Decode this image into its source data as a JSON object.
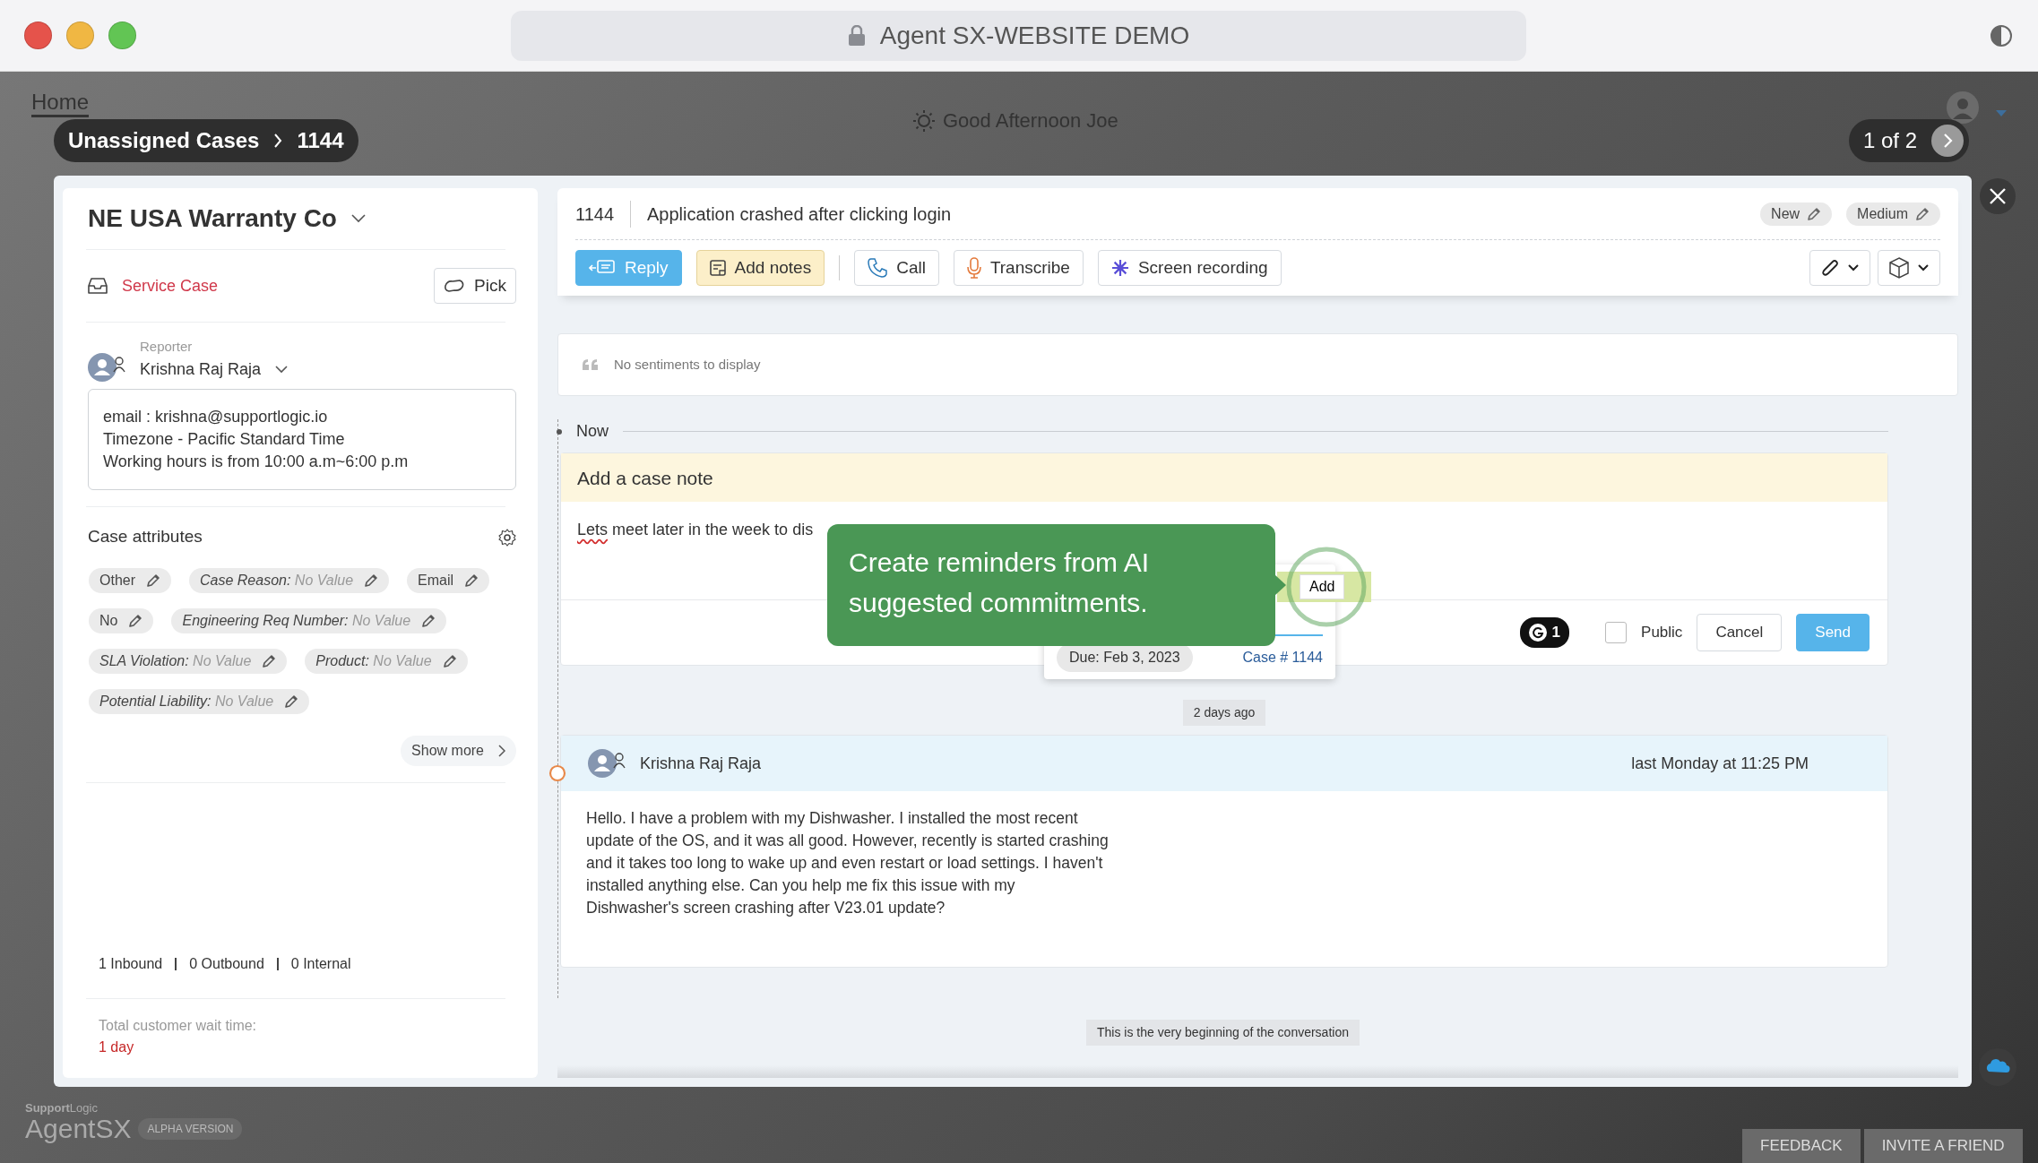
{
  "window": {
    "title": "Agent SX-WEBSITE DEMO"
  },
  "backdrop": {
    "home_tab": "Home",
    "greeting": "Good Afternoon Joe",
    "brand_small": "**Support**Logic",
    "brand": "Agent**SX**",
    "brand_badge": "ALPHA VERSION",
    "footer_buttons": [
      "FEEDBACK",
      "INVITE A FRIEND"
    ]
  },
  "breadcrumb": [
    "Unassigned Cases",
    "1144"
  ],
  "pager": "1 of 2",
  "left_panel": {
    "account": "NE USA Warranty Co",
    "case_type": "Service Case",
    "pick_button": "Pick",
    "reporter_label": "Reporter",
    "reporter_name": "Krishna Raj Raja",
    "contact_note": [
      "email : krishna@supportlogic.io",
      "Timezone - Pacific Standard Time",
      "Working hours is from 10:00 a.m~6:00 p.m"
    ],
    "attributes_title": "Case attributes",
    "attributes": [
      {
        "kind": "plain",
        "text": "Other"
      },
      {
        "kind": "field",
        "label": "Case Reason:",
        "value": "No Value"
      },
      {
        "kind": "plain",
        "text": "Email"
      },
      {
        "kind": "plain",
        "text": "No"
      },
      {
        "kind": "field",
        "label": "Engineering Req Number:",
        "value": "No Value"
      },
      {
        "kind": "field",
        "label": "SLA Violation:",
        "value": "No Value"
      },
      {
        "kind": "field",
        "label": "Product:",
        "value": "No Value"
      },
      {
        "kind": "field",
        "label": "Potential Liability:",
        "value": "No Value"
      }
    ],
    "show_more": "Show more",
    "counts": [
      "1 Inbound",
      "0 Outbound",
      "0 Internal"
    ],
    "wait_label": "Total customer wait time:",
    "wait_value": "1 day"
  },
  "case": {
    "number": "1144",
    "subject": "Application crashed after clicking login",
    "tags": [
      "New",
      "Medium"
    ],
    "toolbar": {
      "groups": [
        [
          {
            "kind": "reply",
            "label": "Reply"
          },
          {
            "kind": "note",
            "label": "Add notes"
          }
        ],
        [
          {
            "kind": "call",
            "label": "Call"
          },
          {
            "kind": "transcribe",
            "label": "Transcribe"
          },
          {
            "kind": "record",
            "label": "Screen recording"
          }
        ]
      ]
    }
  },
  "sentiments": "No sentiments to display",
  "timeline": {
    "now_label": "Now",
    "separator": "2 days ago",
    "end_note": "This is the very beginning of the conversation"
  },
  "note": {
    "title": "Add a case note",
    "text_parts": [
      {
        "text": "Lets",
        "misspelled": true
      },
      {
        "text": " meet later in the week to dis",
        "misspelled": false
      }
    ],
    "suggestion": {
      "add_button": "Add",
      "due": "Due: Feb 3, 2023",
      "case_ref": "Case # 1144"
    },
    "tooltip": "Create reminders from AI suggested commitments.",
    "grammar_count": "1",
    "public": {
      "label": "Public",
      "checked": false
    },
    "cancel": "Cancel",
    "send": "Send"
  },
  "message": {
    "author": "Krishna Raj Raja",
    "time": "last Monday at 11:25 PM",
    "body": "Hello. I have a problem with my Dishwasher. I installed the most recent update of the OS, and it was all good. However, recently is started crashing and it takes too long to wake up and even restart or load settings. I haven't installed anything else. Can you help me fix this issue with my Dishwasher's screen crashing after V23.01 update?"
  }
}
